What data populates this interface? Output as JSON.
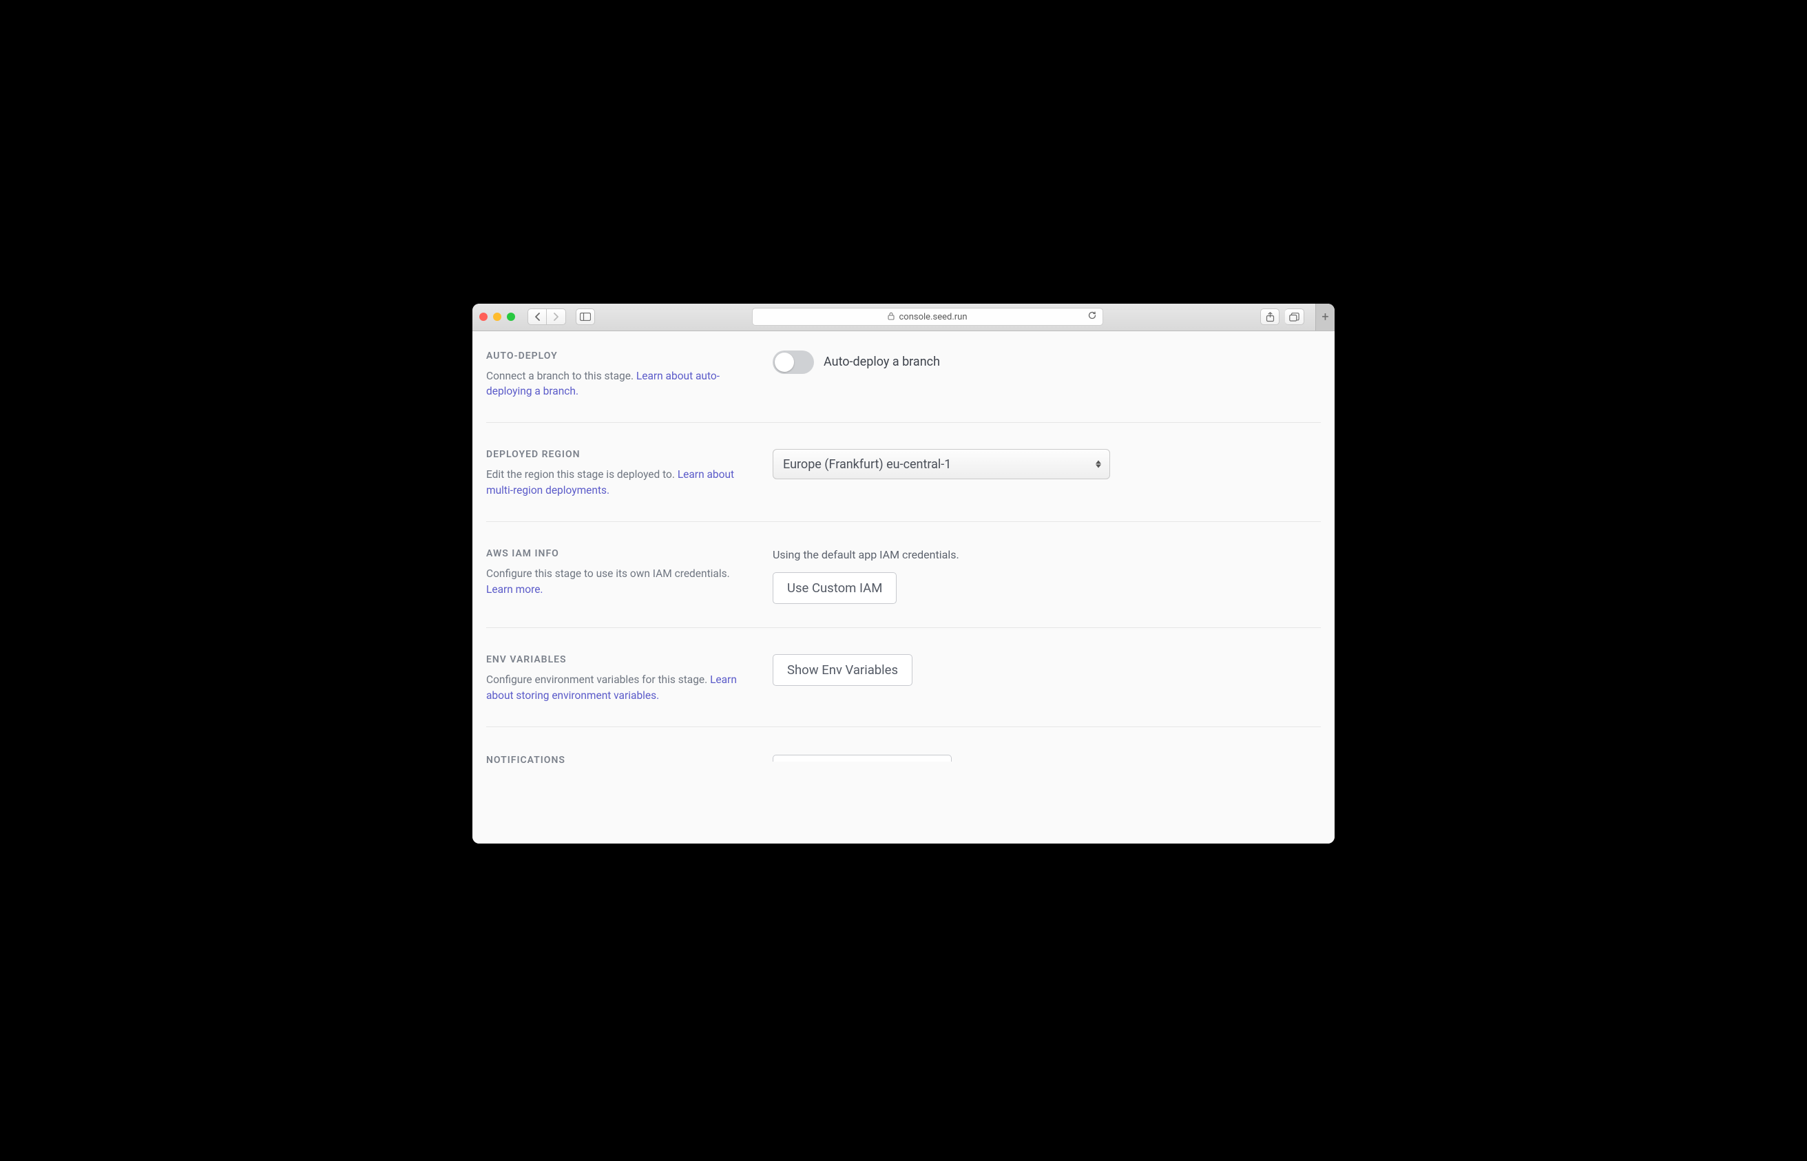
{
  "browser": {
    "url": "console.seed.run"
  },
  "sections": {
    "autoDeploy": {
      "title": "AUTO-DEPLOY",
      "desc": "Connect a branch to this stage. ",
      "link": "Learn about auto-deploying a branch.",
      "toggleLabel": "Auto-deploy a branch",
      "toggleOn": false
    },
    "region": {
      "title": "DEPLOYED REGION",
      "desc": "Edit the region this stage is deployed to. ",
      "link": "Learn about multi-region deployments.",
      "selected": "Europe (Frankfurt) eu-central-1"
    },
    "iam": {
      "title": "AWS IAM INFO",
      "desc": "Configure this stage to use its own IAM credentials. ",
      "link": "Learn more.",
      "status": "Using the default app IAM credentials.",
      "button": "Use Custom IAM"
    },
    "env": {
      "title": "ENV VARIABLES",
      "desc": "Configure environment variables for this stage. ",
      "link": "Learn about storing environment variables.",
      "button": "Show Env Variables"
    },
    "notifications": {
      "title": "NOTIFICATIONS"
    }
  }
}
